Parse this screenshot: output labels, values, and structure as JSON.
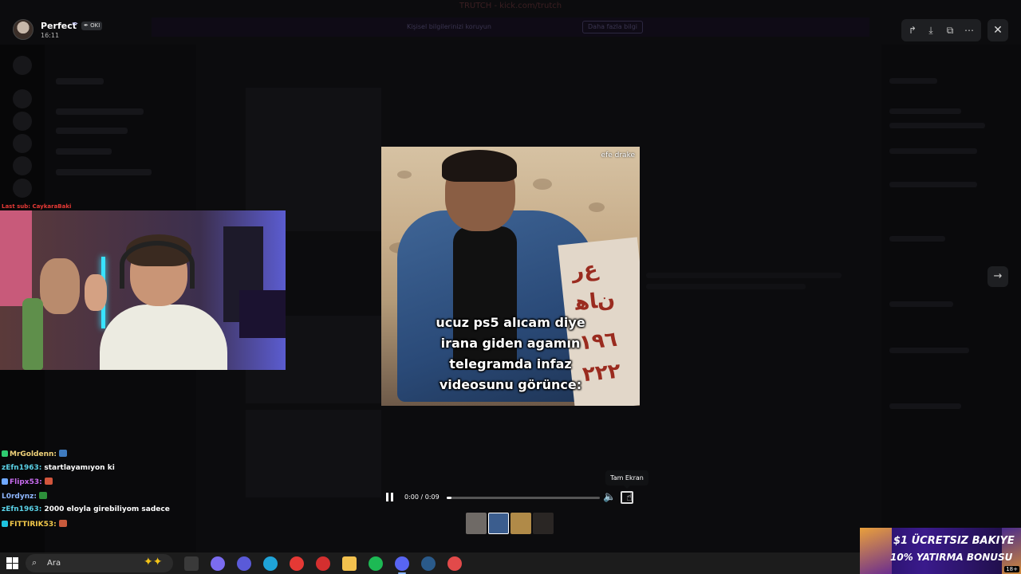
{
  "window": {
    "title": "TRUTCH - kick.com/trutch"
  },
  "notice": {
    "text": "Kişisel bilgilerinizi koruyun",
    "button": "Daha fazla bilgi"
  },
  "uploader": {
    "name": "Perfect",
    "tag": "OKI",
    "time": "16:11"
  },
  "viewer_actions": {
    "share_icon": "forward-icon",
    "download_icon": "download-icon",
    "open_icon": "open-external-icon",
    "more_icon": "more-icon",
    "close_icon": "close-icon",
    "next_icon": "arrow-right-icon"
  },
  "video": {
    "watermark": "efe drake",
    "caption_lines": [
      "ucuz ps5 alıcam diye",
      "irana giden agamın",
      "telegramda infaz",
      "videosunu görünce:"
    ],
    "time": "0:00 / 0:09",
    "progress": 0.03,
    "tooltip": "Tam Ekran"
  },
  "thumbnails": [
    {
      "color": "#6f6a66"
    },
    {
      "color": "#3b5d8e"
    },
    {
      "color": "#b08a48"
    },
    {
      "color": "#2a2624"
    }
  ],
  "stream": {
    "last_sub": "Last sub: CaykaraBaki"
  },
  "chat": [
    {
      "user": "MrGoldenn:",
      "text": "",
      "color": "#f0d27a",
      "badge": "#2ecc71",
      "emote": "#3f7bbf"
    },
    {
      "user": "zEfn1963:",
      "text": "startlayamıyon ki",
      "color": "#5ad1e6",
      "badge": "",
      "emote": ""
    },
    {
      "user": "Flipx53:",
      "text": "",
      "color": "#c96cf0",
      "badge": "#6fa8ff",
      "emote": "#d2553c"
    },
    {
      "user": "L0rdynz:",
      "text": "",
      "color": "#8fb7ff",
      "badge": "",
      "emote": "#2d8f3a"
    },
    {
      "user": "zEfn1963:",
      "text": "2000 eloyla girebiliyom sadece",
      "color": "#5ad1e6",
      "badge": "",
      "emote": ""
    },
    {
      "user": "FITTIRIK53:",
      "text": "",
      "color": "#f3c94a",
      "badge": "#1ec3e0",
      "emote": "#c85a3c"
    }
  ],
  "promo": {
    "line1": "$1 ÜCRETSIZ BAKIYE",
    "line2": "10% YATIRMA BONUSU",
    "age": "18+"
  },
  "taskbar": {
    "search_label": "Ara",
    "apps": [
      {
        "name": "task-view-icon",
        "color": "#3a3a3a"
      },
      {
        "name": "copilot-icon",
        "color": "#7b6cf0"
      },
      {
        "name": "app-circle-icon",
        "color": "#5a5ad8"
      },
      {
        "name": "edge-icon",
        "color": "#1fa3d8"
      },
      {
        "name": "youtube-icon",
        "color": "#e53935"
      },
      {
        "name": "opera-icon",
        "color": "#d32f2f"
      },
      {
        "name": "file-explorer-icon",
        "color": "#f2c14e"
      },
      {
        "name": "spotify-icon",
        "color": "#1db954"
      },
      {
        "name": "discord-icon",
        "color": "#5865f2"
      },
      {
        "name": "steam-icon",
        "color": "#2a5a8a"
      },
      {
        "name": "chess-icon",
        "color": "#e24a4a"
      }
    ]
  }
}
